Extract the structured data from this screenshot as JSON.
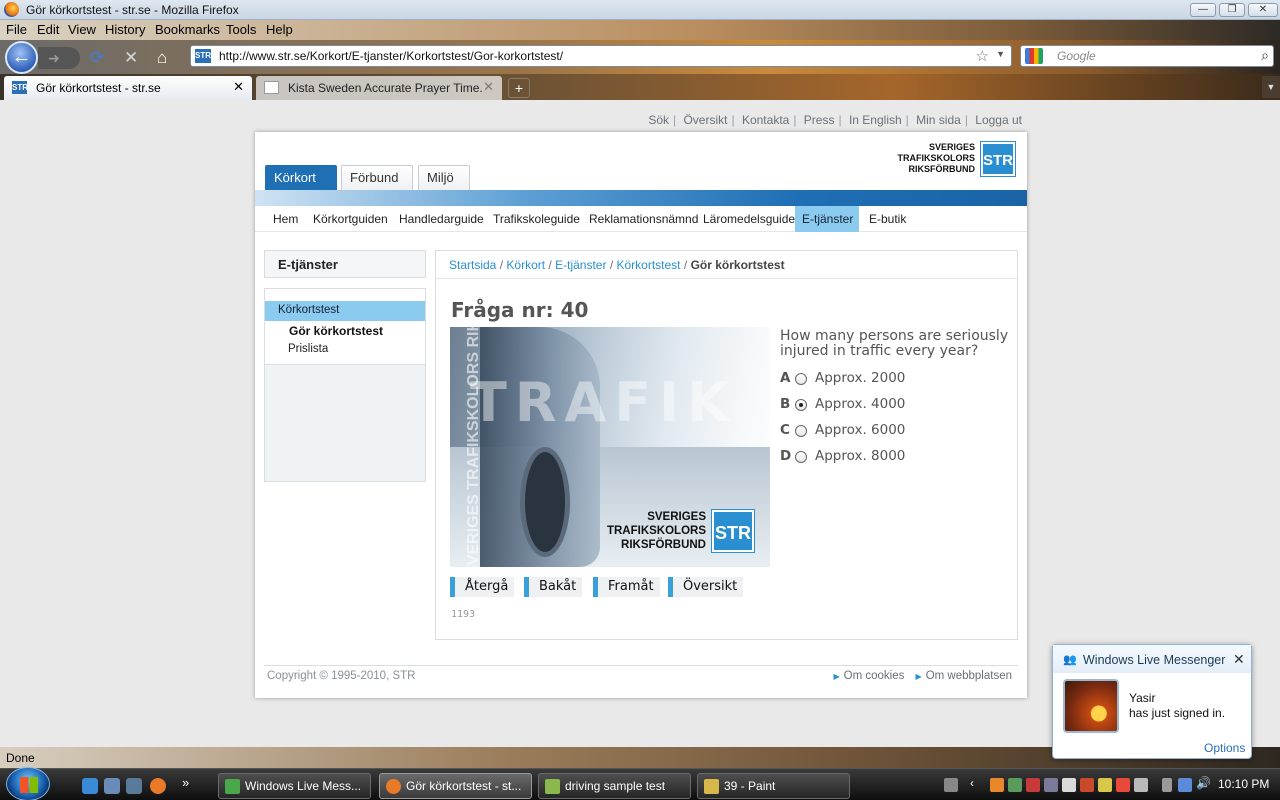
{
  "window": {
    "title": "Gör körkortstest - str.se - Mozilla Firefox",
    "controls": {
      "minimize": "—",
      "maximize": "❐",
      "close": "✕"
    }
  },
  "menubar": {
    "items": [
      "File",
      "Edit",
      "View",
      "History",
      "Bookmarks",
      "Tools",
      "Help"
    ]
  },
  "navbar": {
    "url": "http://www.str.se/Korkort/E-tjanster/Korkortstest/Gor-korkortstest/",
    "site_icon": "STR",
    "search_placeholder": "Google"
  },
  "tabs": [
    {
      "label": "Gör körkortstest - str.se",
      "favicon": "STR",
      "active": true
    },
    {
      "label": "Kista Sweden Accurate Prayer Time...",
      "favicon": "",
      "active": false
    }
  ],
  "page": {
    "toplinks": [
      "Sök",
      "Översikt",
      "Kontakta",
      "Press",
      "In English",
      "Min sida",
      "Logga ut"
    ],
    "logo": {
      "line1": "SVERIGES",
      "line2": "TRAFIKSKOLORS",
      "line3": "RIKSFÖRBUND",
      "badge": "STR"
    },
    "main_tabs": [
      "Körkort",
      "Förbund",
      "Miljö"
    ],
    "subnav": [
      "Hem",
      "Körkortguiden",
      "Handledarguide",
      "Trafikskoleguide",
      "Reklamationsnämnd",
      "Läromedelsguide",
      "E-tjänster",
      "E-butik"
    ],
    "subnav_active": "E-tjänster",
    "sidebar": {
      "heading": "E-tjänster",
      "items": [
        {
          "label": "Körkortstest",
          "selected": true
        },
        {
          "label": "Gör körkortstest",
          "current": true
        },
        {
          "label": "Prislista"
        }
      ]
    },
    "breadcrumb": {
      "links": [
        "Startsida",
        "Körkort",
        "E-tjänster",
        "Körkortstest"
      ],
      "separator": "/",
      "current": "Gör körkortstest"
    },
    "quiz": {
      "heading": "Fråga nr: 40",
      "image_watermark": "TRAFIK",
      "image_side_text": "SVERIGES TRAFIKSKOLORS RIKSFÖRBUND",
      "question": "How many persons are seriously injured in traffic every year?",
      "options": [
        {
          "letter": "A",
          "text": "Approx. 2000",
          "checked": false
        },
        {
          "letter": "B",
          "text": "Approx. 4000",
          "checked": true
        },
        {
          "letter": "C",
          "text": "Approx. 6000",
          "checked": false
        },
        {
          "letter": "D",
          "text": "Approx. 8000",
          "checked": false
        }
      ],
      "buttons": [
        "Återgå",
        "Bakåt",
        "Framåt",
        "Översikt"
      ],
      "question_id": "1193"
    },
    "footer": {
      "copyright": "Copyright © 1995-2010, STR",
      "links": [
        "Om cookies",
        "Om webbplatsen"
      ]
    }
  },
  "statusbar": {
    "text": "Done"
  },
  "messenger_toast": {
    "title": "Windows Live Messenger",
    "name": "Yasir",
    "message": "has just signed in.",
    "options": "Options"
  },
  "taskbar": {
    "buttons": [
      "Windows Live Mess...",
      "Gör körkortstest - st...",
      "driving sample test",
      "39 - Paint"
    ],
    "overflow": "»",
    "clock": "10:10 PM"
  },
  "colors": {
    "accent_blue": "#1f6fb5",
    "link_blue": "#2a8fd0",
    "highlight": "#8ccbf0"
  }
}
